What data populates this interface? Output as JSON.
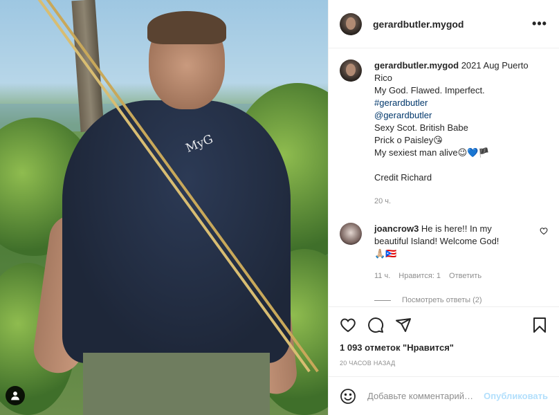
{
  "post": {
    "username": "gerardbutler.mygod",
    "more_icon": "more-horizontal-icon",
    "photo": {
      "watermark": "MyG",
      "user_tag_icon": "user-tag-icon"
    },
    "caption": {
      "username": "gerardbutler.mygod",
      "lines": [
        "2021 Aug Puerto Rico",
        "My God. Flawed. Imperfect.",
        "#gerardbutler",
        "@gerardbutler",
        "Sexy Scot. British Babe",
        "Prick o Paisley😘",
        "My sexiest man alive😉💙🏴",
        "",
        "Credit Richard"
      ],
      "time": "20 ч."
    },
    "comments": [
      {
        "username": "joancrow3",
        "text": "He is here!! In my beautiful Island! Welcome God!",
        "emoji": "🙏🏼🇵🇷",
        "time": "11 ч.",
        "likes": "Нравится: 1",
        "reply": "Ответить",
        "view_replies": "Посмотреть ответы (2)"
      }
    ],
    "actions": {
      "like_icon": "heart-icon",
      "comment_icon": "comment-icon",
      "share_icon": "share-icon",
      "save_icon": "bookmark-icon"
    },
    "likes_text": "1 093 отметок \"Нравится\"",
    "date_text": "20 часов назад",
    "add_comment": {
      "placeholder": "Добавьте комментарий…",
      "publish_label": "Опубликовать"
    },
    "colors": {
      "link": "#00376b",
      "muted": "#8e8e8e",
      "publish_disabled": "#b2dffc"
    }
  }
}
